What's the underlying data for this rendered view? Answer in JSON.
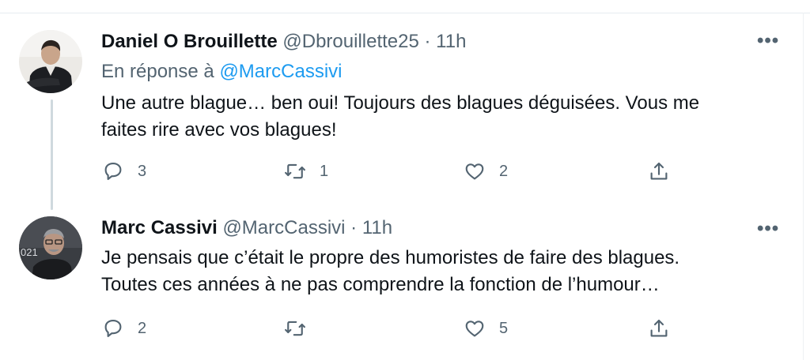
{
  "tweets": [
    {
      "display_name": "Daniel O Brouillette",
      "handle": "@Dbrouillette25",
      "separator": "·",
      "time": "11h",
      "reply_prefix": "En réponse à ",
      "reply_mention": "@MarcCassivi",
      "text_line1": "Une autre blague… ben oui! Toujours des blagues déguisées.  Vous me",
      "text_line2": "faites rire avec vos blagues!",
      "more": "•••",
      "reply_count": "3",
      "retweet_count": "1",
      "like_count": "2"
    },
    {
      "display_name": "Marc Cassivi",
      "handle": "@MarcCassivi",
      "separator": "·",
      "time": "11h",
      "text_line1": "Je pensais que c’était le propre des humoristes de faire des blagues.",
      "text_line2": "Toutes ces années à ne pas comprendre la fonction de l’humour…",
      "more": "•••",
      "reply_count": "2",
      "retweet_count": "",
      "like_count": "5"
    }
  ],
  "icons": {
    "reply": "reply-bubble-icon",
    "retweet": "retweet-icon",
    "like": "heart-icon",
    "share": "share-icon",
    "more": "more-dots-icon"
  },
  "colors": {
    "text": "#0f1419",
    "secondary": "#536471",
    "mention": "#1d9bf0",
    "thread_line": "#cfd9de"
  },
  "avatar2_overlay_text": "021"
}
